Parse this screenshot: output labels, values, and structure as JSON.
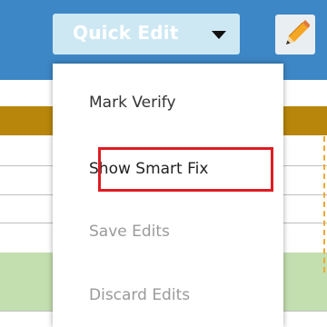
{
  "toolbar": {
    "quick_edit_label": "Quick Edit",
    "icons": [
      "caret-down",
      "pencil"
    ]
  },
  "menu": {
    "items": [
      {
        "label": "Mark Verify",
        "enabled": true
      },
      {
        "label": "Show Smart Fix",
        "enabled": true,
        "highlighted": true
      },
      {
        "label": "Save Edits",
        "enabled": false
      },
      {
        "label": "Discard Edits",
        "enabled": false
      }
    ]
  },
  "colors": {
    "toolbar_bg": "#3d87c6",
    "button_bg": "#cde8f3",
    "header_band": "#b8860b",
    "row_green": "#c3dfb0",
    "highlight": "#e01b22",
    "disabled_text": "#9a9a9a"
  }
}
